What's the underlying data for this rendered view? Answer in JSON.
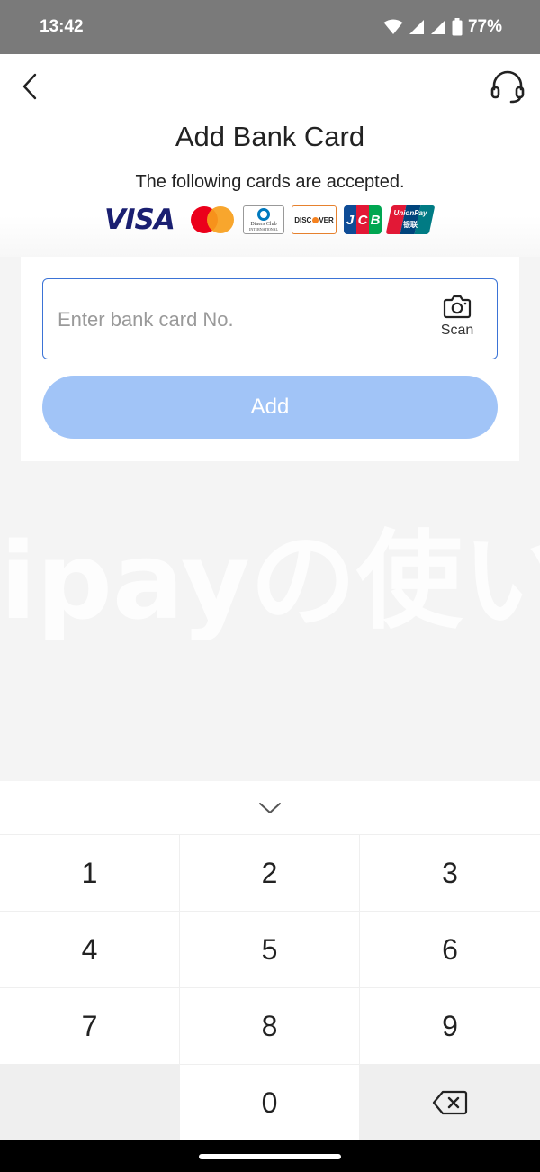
{
  "status_bar": {
    "time": "13:42",
    "battery": "77%"
  },
  "header": {
    "title": "Add Bank Card",
    "accepted_text": "The following cards are accepted."
  },
  "card_logos": {
    "visa": "VISA",
    "diners_line1": "Diners Club",
    "diners_line2": "INTERNATIONAL",
    "discover_prefix": "DISC",
    "discover_suffix": "VER",
    "jcb": [
      "J",
      "C",
      "B"
    ],
    "unionpay_line1": "UnionPay",
    "unionpay_line2": "银联"
  },
  "form": {
    "card_input_placeholder": "Enter bank card No.",
    "card_input_value": "",
    "scan_label": "Scan",
    "add_label": "Add"
  },
  "watermark": "ipayの使い",
  "keypad": {
    "keys": [
      "1",
      "2",
      "3",
      "4",
      "5",
      "6",
      "7",
      "8",
      "9",
      "0"
    ]
  },
  "colors": {
    "accent": "#3b73d6",
    "button_disabled": "#a1c4f7",
    "status_bar": "#7a7a7a"
  }
}
